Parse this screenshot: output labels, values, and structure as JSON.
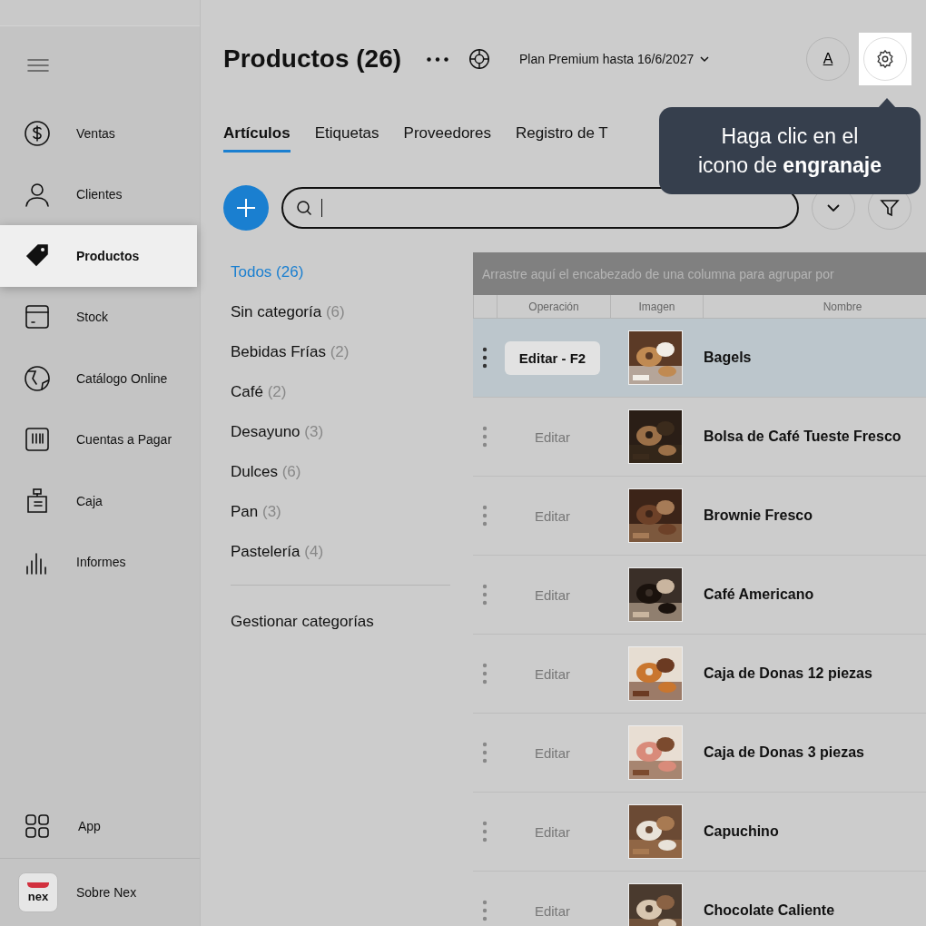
{
  "sidebar": {
    "items": [
      {
        "label": "Ventas",
        "selected": false
      },
      {
        "label": "Clientes",
        "selected": false
      },
      {
        "label": "Productos",
        "selected": true
      },
      {
        "label": "Stock",
        "selected": false
      },
      {
        "label": "Catálogo Online",
        "selected": false
      },
      {
        "label": "Cuentas a Pagar",
        "selected": false
      },
      {
        "label": "Caja",
        "selected": false
      },
      {
        "label": "Informes",
        "selected": false
      }
    ],
    "app": "App",
    "about": {
      "logo": "nex",
      "label": "Sobre Nex"
    }
  },
  "header": {
    "title": "Productos (26)",
    "plan": "Plan Premium hasta 16/6/2027",
    "avatar": "A"
  },
  "tabs": [
    {
      "label": "Artículos",
      "selected": true
    },
    {
      "label": "Etiquetas",
      "selected": false
    },
    {
      "label": "Proveedores",
      "selected": false
    },
    {
      "label": "Registro de T",
      "selected": false
    }
  ],
  "tooltip": "Haga clic en el icono de **engranaje**",
  "categories": [
    {
      "name": "Todos",
      "count": "(26)",
      "selected": true
    },
    {
      "name": "Sin categoría",
      "count": "(6)",
      "selected": false
    },
    {
      "name": "Bebidas Frías",
      "count": "(2)",
      "selected": false
    },
    {
      "name": "Café",
      "count": "(2)",
      "selected": false
    },
    {
      "name": "Desayuno",
      "count": "(3)",
      "selected": false
    },
    {
      "name": "Dulces",
      "count": "(6)",
      "selected": false
    },
    {
      "name": "Pan",
      "count": "(3)",
      "selected": false
    },
    {
      "name": "Pastelería",
      "count": "(4)",
      "selected": false
    }
  ],
  "manage_categories": "Gestionar categorías",
  "table": {
    "group_hint": "Arrastre aquí el encabezado de una columna para agrupar por",
    "columns": [
      "Operación",
      "Imagen",
      "Nombre"
    ],
    "rows": [
      {
        "action": "Editar - F2",
        "name": "Bagels",
        "selected": true
      },
      {
        "action": "Editar",
        "name": "Bolsa de Café Tueste Fresco",
        "selected": false
      },
      {
        "action": "Editar",
        "name": "Brownie Fresco",
        "selected": false
      },
      {
        "action": "Editar",
        "name": "Café Americano",
        "selected": false
      },
      {
        "action": "Editar",
        "name": "Caja de Donas 12 piezas",
        "selected": false
      },
      {
        "action": "Editar",
        "name": "Caja de Donas 3 piezas",
        "selected": false
      },
      {
        "action": "Editar",
        "name": "Capuchino",
        "selected": false
      },
      {
        "action": "Editar",
        "name": "Chocolate Caliente",
        "selected": false
      }
    ]
  }
}
